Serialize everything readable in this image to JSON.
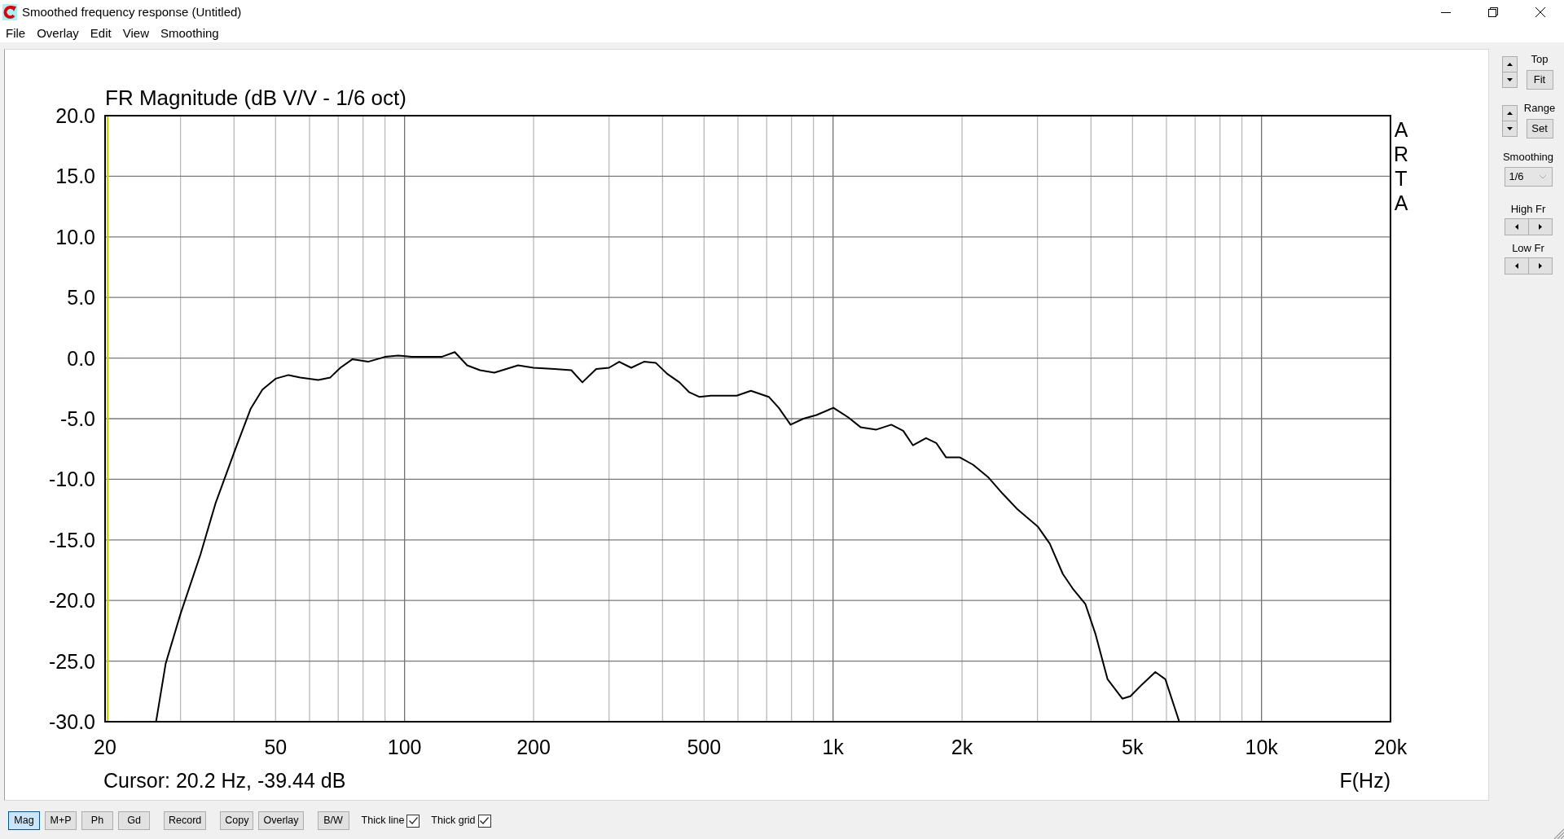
{
  "window": {
    "title": "Smoothed frequency response (Untitled)"
  },
  "menu": [
    "File",
    "Overlay",
    "Edit",
    "View",
    "Smoothing"
  ],
  "plot": {
    "side_label": "ARTA",
    "cursor": "Cursor: 20.2 Hz, -39.44 dB",
    "chart_data": {
      "type": "line",
      "title": "FR Magnitude (dB V/V - 1/6 oct)",
      "xlabel": "F(Hz)",
      "log": "x",
      "grid": true,
      "xlim": [
        20,
        20000
      ],
      "ylim": [
        -30,
        20
      ],
      "xticks": [
        {
          "value": 20,
          "label": "20"
        },
        {
          "value": 50,
          "label": "50"
        },
        {
          "value": 100,
          "label": "100"
        },
        {
          "value": 200,
          "label": "200"
        },
        {
          "value": 500,
          "label": "500"
        },
        {
          "value": 1000,
          "label": "1k"
        },
        {
          "value": 2000,
          "label": "2k"
        },
        {
          "value": 5000,
          "label": "5k"
        },
        {
          "value": 10000,
          "label": "10k"
        },
        {
          "value": 20000,
          "label": "20k"
        }
      ],
      "yticks": [
        {
          "value": 20,
          "label": "20.0"
        },
        {
          "value": 15,
          "label": "15.0"
        },
        {
          "value": 10,
          "label": "10.0"
        },
        {
          "value": 5,
          "label": "5.0"
        },
        {
          "value": 0,
          "label": "0.0"
        },
        {
          "value": -5,
          "label": "-5.0"
        },
        {
          "value": -10,
          "label": "-10.0"
        },
        {
          "value": -15,
          "label": "-15.0"
        },
        {
          "value": -20,
          "label": "-20.0"
        },
        {
          "value": -25,
          "label": "-25.0"
        },
        {
          "value": -30,
          "label": "-30.0"
        }
      ],
      "x": [
        26.3,
        27.7,
        30,
        33.4,
        36.2,
        40.3,
        43.7,
        46.6,
        50,
        53.6,
        57.1,
        62.9,
        67.1,
        70.8,
        75.5,
        82.2,
        90,
        96.6,
        104,
        113,
        122,
        131,
        140,
        150,
        162,
        184,
        200,
        224,
        245,
        260,
        280,
        300,
        317,
        338,
        362,
        386,
        410,
        438,
        461,
        487,
        519,
        556,
        596,
        643,
        708,
        747,
        796,
        853,
        915,
        1002,
        1086,
        1159,
        1262,
        1368,
        1458,
        1537,
        1648,
        1741,
        1836,
        1978,
        2122,
        2298,
        2490,
        2698,
        3005,
        3205,
        3437,
        3622,
        3882,
        4100,
        4372,
        4734,
        4943,
        5272,
        5651,
        5963,
        6428
      ],
      "series": [
        {
          "color": "#000000",
          "values": [
            -30,
            -25.2,
            -21.1,
            -16.2,
            -12,
            -7.5,
            -4.2,
            -2.6,
            -1.7,
            -1.4,
            -1.6,
            -1.8,
            -1.6,
            -0.8,
            -0.1,
            -0.3,
            0.1,
            0.2,
            0.1,
            0.1,
            0.1,
            0.5,
            -0.6,
            -1,
            -1.2,
            -0.6,
            -0.8,
            -0.9,
            -1,
            -2,
            -0.9,
            -0.8,
            -0.3,
            -0.8,
            -0.3,
            -0.4,
            -1.3,
            -2,
            -2.8,
            -3.2,
            -3.1,
            -3.1,
            -3.1,
            -2.7,
            -3.2,
            -4.1,
            -5.5,
            -5,
            -4.7,
            -4.1,
            -4.9,
            -5.7,
            -5.9,
            -5.5,
            -6,
            -7.2,
            -6.6,
            -7,
            -8.2,
            -8.2,
            -8.8,
            -9.8,
            -11.2,
            -12.5,
            -13.9,
            -15.3,
            -17.8,
            -19,
            -20.3,
            -22.8,
            -26.5,
            -28.1,
            -27.9,
            -26.9,
            -25.9,
            -26.5,
            -30
          ]
        }
      ],
      "ref_lines": [
        {
          "axis": "x",
          "value": 20.2,
          "color": "#d2d200"
        }
      ]
    }
  },
  "side_panel": [
    {
      "kind": "spin",
      "label": "Top",
      "button": "Fit"
    },
    {
      "kind": "spin",
      "label": "Range",
      "button": "Set"
    },
    {
      "kind": "dropdown",
      "label": "Smoothing",
      "value": "1/6"
    },
    {
      "kind": "stepper",
      "label": "High Fr"
    },
    {
      "kind": "stepper",
      "label": "Low Fr"
    }
  ],
  "toolbar_groups": [
    [
      {
        "kind": "toggle",
        "label": "Mag",
        "selected": true
      },
      {
        "kind": "toggle",
        "label": "M+P",
        "selected": false
      },
      {
        "kind": "toggle",
        "label": "Ph",
        "selected": false
      },
      {
        "kind": "toggle",
        "label": "Gd",
        "selected": false
      }
    ],
    [
      {
        "kind": "button",
        "label": "Record"
      }
    ],
    [
      {
        "kind": "button",
        "label": "Copy"
      },
      {
        "kind": "button",
        "label": "Overlay"
      }
    ],
    [
      {
        "kind": "button",
        "label": "B/W"
      }
    ],
    [
      {
        "kind": "checkbox",
        "label": "Thick line",
        "checked": true
      },
      {
        "kind": "checkbox",
        "label": "Thick grid",
        "checked": true
      }
    ]
  ]
}
